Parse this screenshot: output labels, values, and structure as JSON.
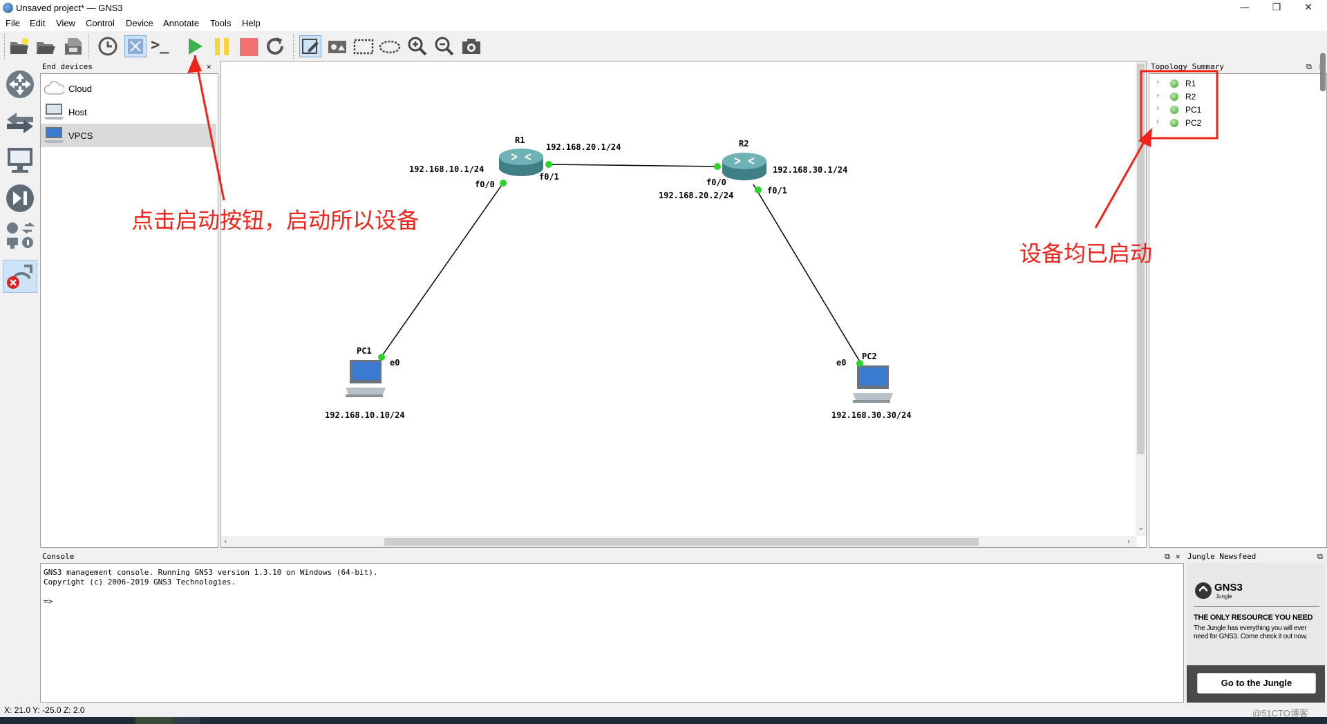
{
  "window": {
    "title": "Unsaved project* — GNS3",
    "controls": [
      "—",
      "❐",
      "✕"
    ]
  },
  "menubar": [
    "File",
    "Edit",
    "View",
    "Control",
    "Device",
    "Annotate",
    "Tools",
    "Help"
  ],
  "toolbar": {
    "console_all_icon": ">_"
  },
  "end_devices": {
    "title": "End devices",
    "items": [
      "Cloud",
      "Host",
      "VPCS"
    ]
  },
  "topology": {
    "routers": [
      {
        "name": "R1",
        "ips": [
          "192.168.20.1/24",
          "192.168.10.1/24"
        ],
        "ports": [
          "f0/0",
          "f0/1"
        ]
      },
      {
        "name": "R2",
        "ips": [
          "192.168.30.1/24",
          "192.168.20.2/24"
        ],
        "ports": [
          "f0/0",
          "f0/1"
        ]
      }
    ],
    "pcs": [
      {
        "name": "PC1",
        "port": "e0",
        "ip": "192.168.10.10/24"
      },
      {
        "name": "PC2",
        "port": "e0",
        "ip": "192.168.30.30/24"
      }
    ]
  },
  "topology_summary": {
    "title": "Topology Summary",
    "items": [
      "R1",
      "R2",
      "PC1",
      "PC2"
    ]
  },
  "console": {
    "title": "Console",
    "text": "GNS3 management console. Running GNS3 version 1.3.10 on Windows (64-bit).\nCopyright (c) 2006-2019 GNS3 Technologies.\n\n=>"
  },
  "jungle": {
    "title": "Jungle Newsfeed",
    "logo": "GNS3",
    "logo_sub": "Jungle",
    "headline": "THE ONLY RESOURCE YOU NEED",
    "body": "The Jungle has everything you will ever need for GNS3. Come check it out now.",
    "button": "Go to the Jungle"
  },
  "statusbar": {
    "coords": "X: 21.0 Y: -25.0 Z: 2.0",
    "watermark": "@51CTO博客"
  },
  "annotations": {
    "start_hint": "点击启动按钮，启动所以设备",
    "started_hint": "设备均已启动"
  },
  "colors": {
    "accent_red": "#f0231a",
    "link_green": "#2bd42b",
    "start_green": "#3cb04a",
    "pause_yellow": "#f5d33a",
    "stop_red": "#f07070"
  }
}
